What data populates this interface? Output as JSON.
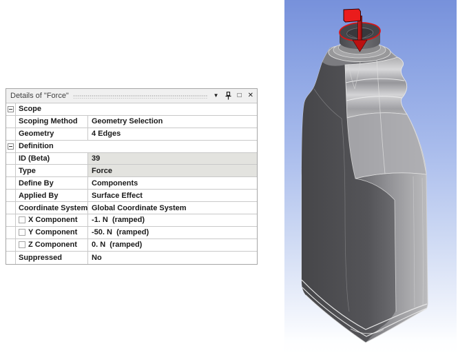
{
  "details_panel": {
    "title": "Details of \"Force\"",
    "icons": {
      "dropdown": "▼",
      "pin": "pushpin",
      "float": "□",
      "close": "✕"
    },
    "rows": [
      {
        "type": "section",
        "label": "Scope"
      },
      {
        "type": "prop",
        "label": "Scoping Method",
        "value": "Geometry Selection"
      },
      {
        "type": "prop",
        "label": "Geometry",
        "value": "4 Edges"
      },
      {
        "type": "section",
        "label": "Definition"
      },
      {
        "type": "prop",
        "label": "ID (Beta)",
        "value": "39",
        "shaded": true
      },
      {
        "type": "prop",
        "label": "Type",
        "value": "Force",
        "shaded": true
      },
      {
        "type": "prop",
        "label": "Define By",
        "value": "Components"
      },
      {
        "type": "prop",
        "label": "Applied By",
        "value": "Surface Effect"
      },
      {
        "type": "prop",
        "label": "Coordinate System",
        "value": "Global Coordinate System"
      },
      {
        "type": "prop",
        "label": "X Component",
        "value": "-1. N  (ramped)",
        "checkbox": true
      },
      {
        "type": "prop",
        "label": "Y Component",
        "value": "-50. N  (ramped)",
        "checkbox": true
      },
      {
        "type": "prop",
        "label": "Z Component",
        "value": "0. N  (ramped)",
        "checkbox": true
      },
      {
        "type": "prop",
        "label": "Suppressed",
        "value": "No"
      }
    ],
    "colors": {
      "header_bg": "#f0f0f0",
      "shaded_cell": "#e3e3df",
      "grid_line": "#c8c8c8",
      "border": "#a5a5a5"
    }
  },
  "viewport": {
    "background_top": "#7791db",
    "background_bottom": "#ffffff",
    "annotation": {
      "force_arrow": "red-downward-force-arrow",
      "selected_edges_highlight": "red-ellipse-on-neck-rim",
      "accent_color": "#dc1414"
    },
    "model_colors": {
      "dark_face": "#4a4a4e",
      "light_face": "#b8b8ba",
      "edge_line": "#e6e6e6"
    }
  }
}
